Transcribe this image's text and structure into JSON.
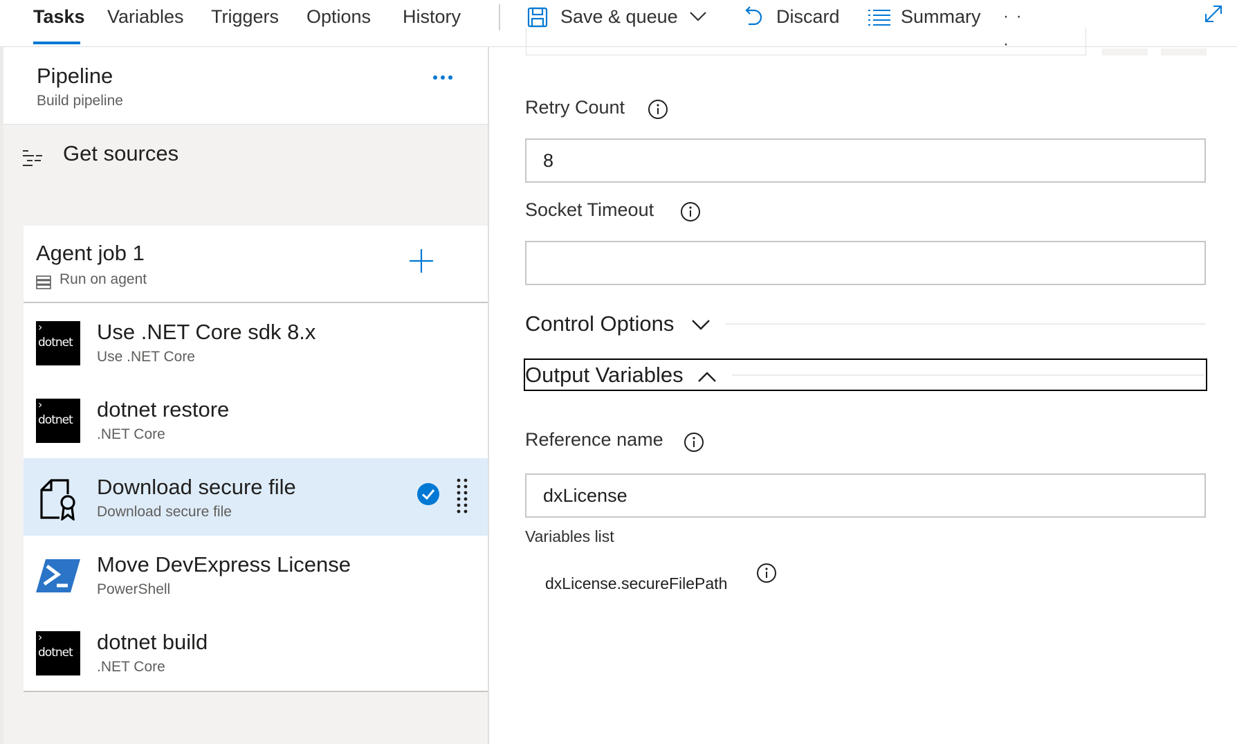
{
  "tabs": [
    {
      "label": "Tasks",
      "active": true
    },
    {
      "label": "Variables",
      "active": false
    },
    {
      "label": "Triggers",
      "active": false
    },
    {
      "label": "Options",
      "active": false
    },
    {
      "label": "History",
      "active": false
    }
  ],
  "toolbar": {
    "save_queue_label": "Save & queue",
    "discard_label": "Discard",
    "summary_label": "Summary",
    "more_label": "· · ·"
  },
  "pipeline": {
    "title": "Pipeline",
    "subtitle": "Build pipeline",
    "more_label": "•••"
  },
  "get_sources": {
    "label": "Get sources"
  },
  "agent_job": {
    "title": "Agent job 1",
    "subtitle": "Run on agent"
  },
  "tasks": [
    {
      "title": "Use .NET Core sdk 8.x",
      "subtitle": "Use .NET Core",
      "icon": "dotnet-icon",
      "icon_text": "dotnet",
      "selected": false
    },
    {
      "title": "dotnet restore",
      "subtitle": ".NET Core",
      "icon": "dotnet-icon",
      "icon_text": "dotnet",
      "selected": false
    },
    {
      "title": "Download secure file",
      "subtitle": "Download secure file",
      "icon": "secure-file-icon",
      "selected": true
    },
    {
      "title": "Move DevExpress License",
      "subtitle": "PowerShell",
      "icon": "powershell-icon",
      "selected": false
    },
    {
      "title": "dotnet build",
      "subtitle": ".NET Core",
      "icon": "dotnet-icon",
      "icon_text": "dotnet",
      "selected": false
    }
  ],
  "form": {
    "retry_count": {
      "label": "Retry Count",
      "value": "8"
    },
    "socket_timeout": {
      "label": "Socket Timeout",
      "value": ""
    },
    "control_options": {
      "label": "Control Options",
      "expanded": false
    },
    "output_variables": {
      "label": "Output Variables",
      "expanded": true
    },
    "reference_name": {
      "label": "Reference name",
      "value": "dxLicense"
    },
    "variables_list": {
      "label": "Variables list",
      "items": [
        "dxLicense.secureFilePath"
      ]
    }
  },
  "colors": {
    "accent": "#0078d4",
    "selected_row": "#deecf9",
    "powershell": "#2b74c7"
  }
}
